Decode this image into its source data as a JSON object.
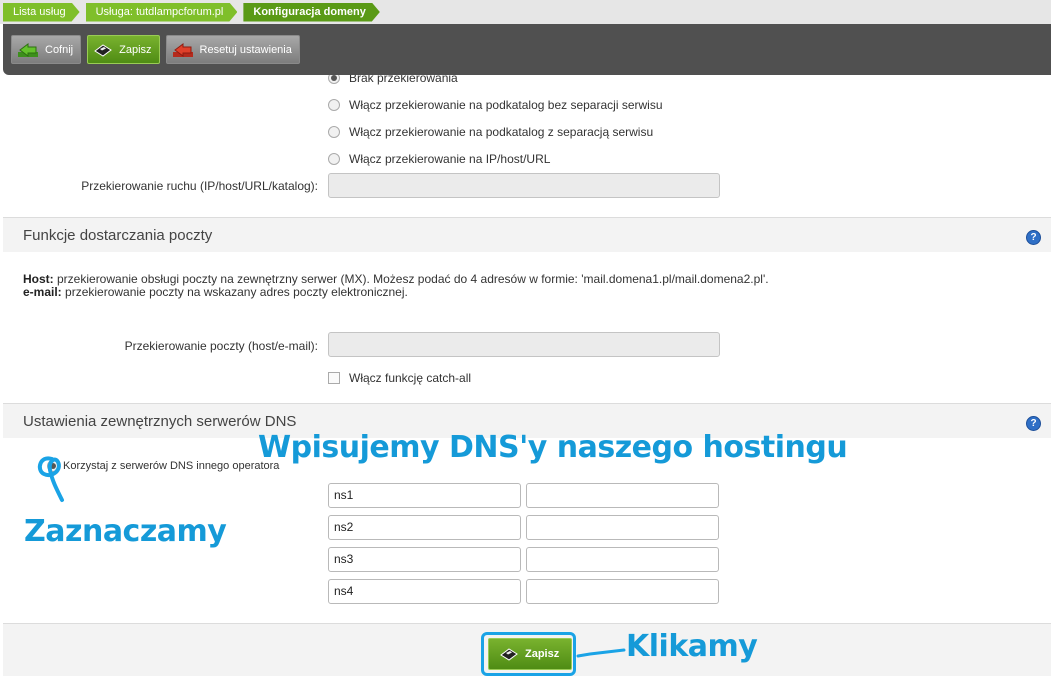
{
  "breadcrumb": {
    "items": [
      {
        "label": "Lista usług"
      },
      {
        "label": "Usługa: tutdlampcforum.pl"
      },
      {
        "label": "Konfiguracja domeny"
      }
    ]
  },
  "toolbar": {
    "back_label": "Cofnij",
    "save_label": "Zapisz",
    "reset_label": "Resetuj ustawienia"
  },
  "redirect": {
    "options": [
      {
        "label": "Brak przekierowania",
        "checked": true
      },
      {
        "label": "Włącz przekierowanie na podkatalog bez separacji serwisu",
        "checked": false
      },
      {
        "label": "Włącz przekierowanie na podkatalog z separacją serwisu",
        "checked": false
      },
      {
        "label": "Włącz przekierowanie na IP/host/URL",
        "checked": false
      }
    ],
    "traffic_label": "Przekierowanie ruchu (IP/host/URL/katalog):",
    "traffic_value": ""
  },
  "mail": {
    "title": "Funkcje dostarczania poczty",
    "info_host_key": "Host:",
    "info_host_text": " przekierowanie obsługi poczty na zewnętrzny serwer (MX). Możesz podać do 4 adresów w formie: 'mail.domena1.pl/mail.domena2.pl'.",
    "info_email_key": "e-mail:",
    "info_email_text": " przekierowanie poczty na wskazany adres poczty elektronicznej.",
    "redirect_label": "Przekierowanie poczty (host/e-mail):",
    "redirect_value": "",
    "catchall_label": "Włącz funkcję catch-all",
    "catchall_checked": false
  },
  "dns": {
    "title": "Ustawienia zewnętrznych serwerów DNS",
    "use_other_label": "Korzystaj z serwerów DNS innego operatora",
    "use_other_checked": true,
    "servers": [
      {
        "name": "ns1",
        "ip": ""
      },
      {
        "name": "ns2",
        "ip": ""
      },
      {
        "name": "ns3",
        "ip": ""
      },
      {
        "name": "ns4",
        "ip": ""
      }
    ]
  },
  "footer": {
    "save_label": "Zapisz"
  },
  "annotations": {
    "dns_hint": "Wpisujemy DNS'y naszego hostingu",
    "check_hint": "Zaznaczamy",
    "click_hint": "Klikamy"
  },
  "colors": {
    "breadcrumb_green": "#7fbf2a",
    "toolbar_dark": "#505050",
    "save_green": "#4f8c14",
    "annotation_blue": "#159ad8",
    "help_blue": "#2f6fc6"
  }
}
